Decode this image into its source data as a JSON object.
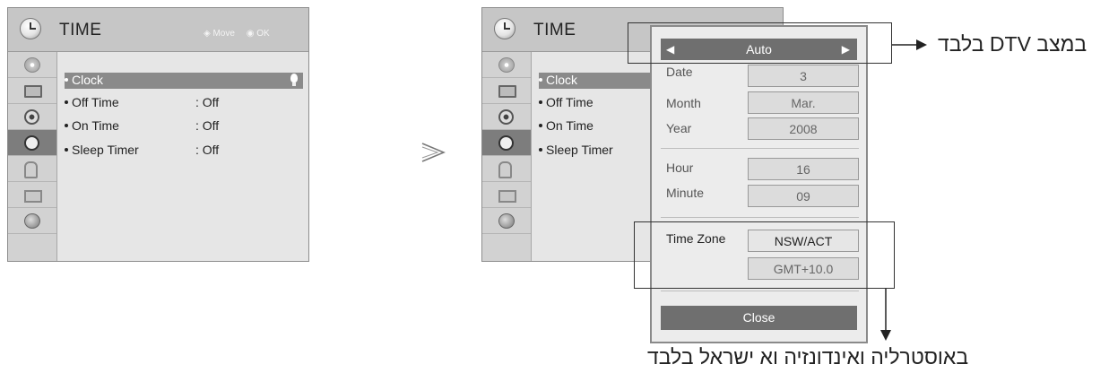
{
  "menu": {
    "title": "TIME",
    "hint_move": "Move",
    "hint_ok": "OK",
    "side_icons": [
      "disc-icon",
      "screen-icon",
      "speaker-icon",
      "clock-icon",
      "lock-icon",
      "toolbox-icon",
      "network-icon"
    ],
    "selected_side_icon": "clock-icon",
    "items": [
      {
        "label": "Clock",
        "value": ""
      },
      {
        "label": "Off Time",
        "value": ": Off"
      },
      {
        "label": "On Time",
        "value": ": Off"
      },
      {
        "label": "Sleep Timer",
        "value": ": Off"
      }
    ],
    "highlighted_item": "Clock"
  },
  "popup": {
    "mode_value": "Auto",
    "fields": [
      {
        "label": "Date",
        "value": "3"
      },
      {
        "label": "Month",
        "value": "Mar."
      },
      {
        "label": "Year",
        "value": "2008"
      },
      {
        "label": "Hour",
        "value": "16"
      },
      {
        "label": "Minute",
        "value": "09"
      }
    ],
    "time_zone_label": "Time Zone",
    "time_zone_value": "NSW/ACT",
    "gmt_offset": "GMT+10.0",
    "close_label": "Close"
  },
  "notes": {
    "dtv_only": "במצב DTV בלבד",
    "regions_only": "באוסטרליה ואינדונזיה וא ישראל  בלבד"
  },
  "colors": {
    "header": "#c6c6c6",
    "highlight": "#8a8a8a",
    "popup_bar": "#6f6f6f"
  }
}
